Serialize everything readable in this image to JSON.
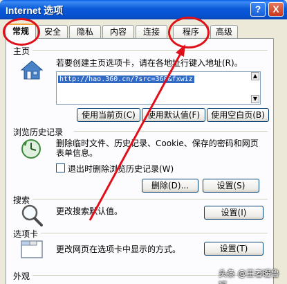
{
  "window": {
    "title": "Internet 选项",
    "help_label": "?",
    "close_label": "X"
  },
  "tabs": [
    {
      "label": "常规"
    },
    {
      "label": "安全"
    },
    {
      "label": "隐私"
    },
    {
      "label": "内容"
    },
    {
      "label": "连接"
    },
    {
      "label": "程序"
    },
    {
      "label": "高级"
    }
  ],
  "homepage": {
    "title": "主页",
    "description": "若要创建主页选项卡，请在各地址行键入地址(R)。",
    "url": "http://hao.360.cn/?src=360&fxwiz",
    "buttons": [
      "使用当前页(C)",
      "使用默认值(F)",
      "使用空白页(B)"
    ]
  },
  "history": {
    "title": "浏览历史记录",
    "description_line1": "删除临时文件、历史记录、Cookie、保存的密码和网页",
    "description_line2": "表单信息。",
    "checkbox_label": "退出时删除浏览历史记录(W)",
    "delete_label": "删除(D)...",
    "settings_label": "设置(S)"
  },
  "search": {
    "title": "搜索",
    "description": "更改搜索默认值。",
    "settings_label": "设置(I)"
  },
  "tabs_section": {
    "title": "选项卡",
    "description": "更改网页在选项卡中显示的方式。",
    "settings_label": "设置(T)"
  },
  "appearance": {
    "title": "外观"
  },
  "watermark": "头条 @王者暖鲁班",
  "colors": {
    "titlebar": "#0A59D8",
    "annotation": "#E0101A",
    "dialog_bg": "#ECE9D8"
  }
}
